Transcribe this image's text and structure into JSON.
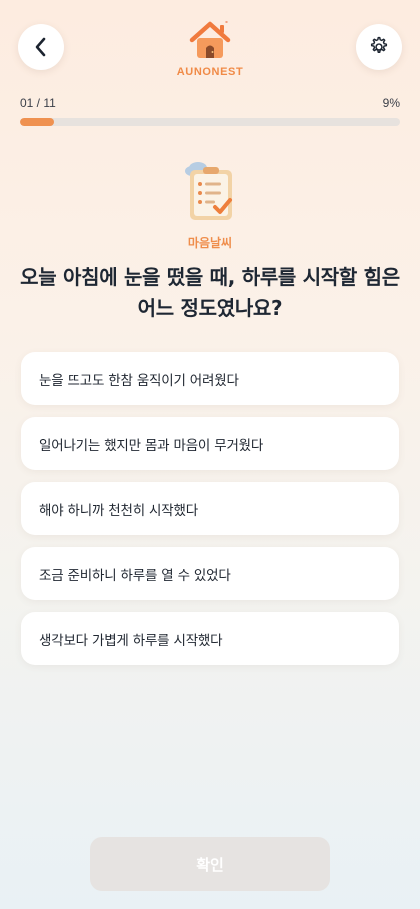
{
  "header": {
    "back_icon": "chevron-left-icon",
    "settings_icon": "gear-icon",
    "brand": "AUNONEST",
    "logo_icon": "house-icon"
  },
  "progress": {
    "counter": "01 / 11",
    "percent_label": "9%",
    "fraction": 0.09,
    "accent": "#ef9150"
  },
  "question": {
    "icon": "clipboard-checklist-icon",
    "category": "마음날씨",
    "text": "오늘 아침에 눈을 떴을 때, 하루를 시작할 힘은 어느 정도였나요?"
  },
  "options": [
    "눈을 뜨고도 한참 움직이기 어려웠다",
    "일어나기는 했지만 몸과 마음이 무거웠다",
    "해야 하니까 천천히 시작했다",
    "조금 준비하니 하루를 열 수 있었다",
    "생각보다 가볍게 하루를 시작했다"
  ],
  "confirm": {
    "label": "확인",
    "enabled": false
  }
}
